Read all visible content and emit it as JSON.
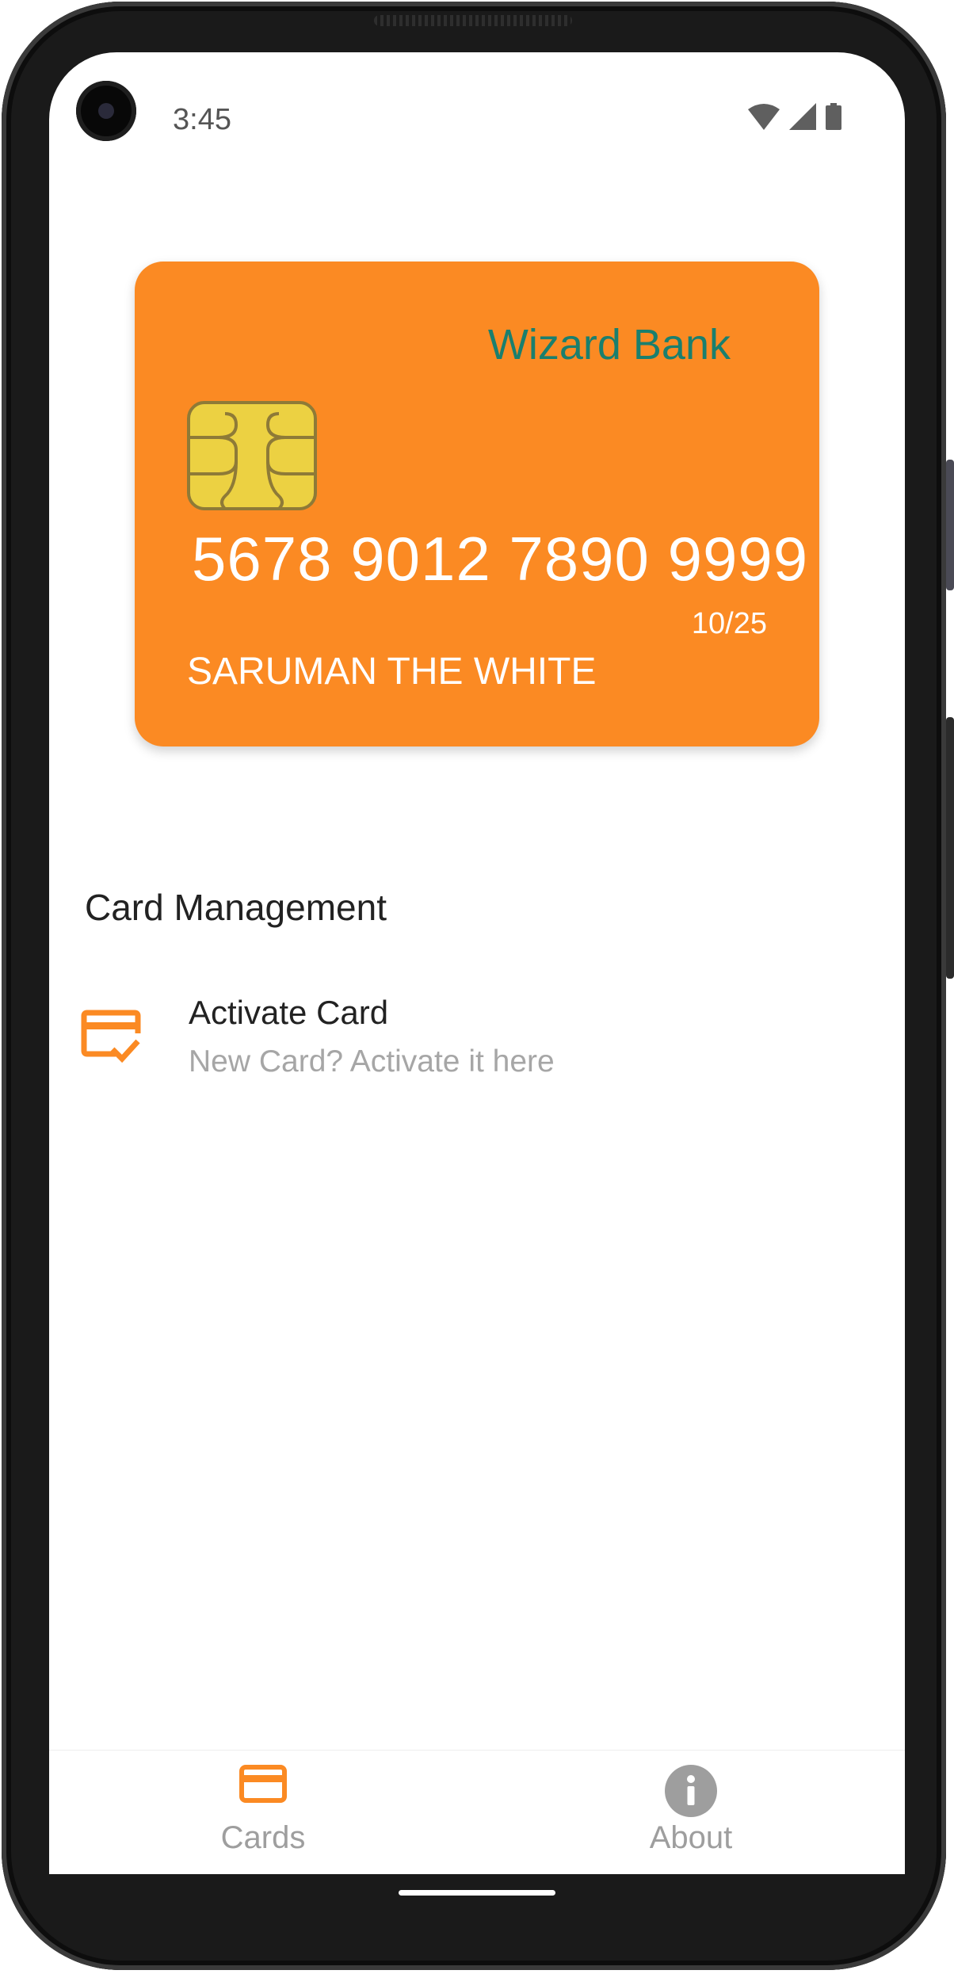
{
  "status_bar": {
    "time": "3:45"
  },
  "card": {
    "bank_name": "Wizard Bank",
    "number": "5678 9012 7890 9999",
    "expiry": "10/25",
    "holder": "SARUMAN THE WHITE",
    "color": "#fb8a23",
    "bank_color": "#1a7f6e"
  },
  "section": {
    "title": "Card Management",
    "items": [
      {
        "title": "Activate Card",
        "subtitle": "New Card? Activate it here",
        "icon": "card-check-icon"
      }
    ]
  },
  "bottom_nav": {
    "items": [
      {
        "label": "Cards",
        "icon": "credit-card-icon",
        "active": true
      },
      {
        "label": "About",
        "icon": "info-icon",
        "active": false
      }
    ]
  },
  "colors": {
    "accent": "#fb8a23",
    "inactive": "#9e9e9e"
  }
}
